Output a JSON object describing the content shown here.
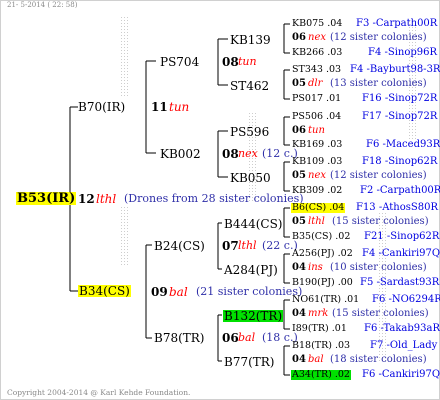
{
  "stamp": "21- 5-2014 ( 22: 58)",
  "copyright": "Copyright 2004-2014 @ Karl Kehde Foundation.",
  "root": {
    "name": "B53(IR)",
    "gen": "12",
    "mark": "lthl",
    "note": "(Drones from 28 sister colonies)"
  },
  "parents": [
    {
      "name": "B70(IR)",
      "gen": "11",
      "mark": "tun",
      "note": ""
    },
    {
      "name": "B34(CS)",
      "gen": "09",
      "mark": "bal",
      "note": "(21 sister colonies)"
    }
  ],
  "grandparents": [
    {
      "name": "PS704",
      "gen": "08",
      "mark": "tun",
      "note": ""
    },
    {
      "name": "KB002",
      "gen": "08",
      "mark": "nex",
      "note": "(12 c.)"
    },
    {
      "name": "B24(CS)",
      "gen": "07",
      "mark": "lthl",
      "note": "(22 c.)"
    },
    {
      "name": "B78(TR)",
      "gen": "06",
      "mark": "bal",
      "note": "(18 c.)"
    }
  ],
  "great": [
    {
      "name": "KB139"
    },
    {
      "name": "ST462"
    },
    {
      "name": "PS596"
    },
    {
      "name": "KB050"
    },
    {
      "name": "B444(CS)"
    },
    {
      "name": "A284(PJ)"
    },
    {
      "name": "B132(TR)"
    },
    {
      "name": "B77(TR)"
    }
  ],
  "leaves": [
    {
      "left": "KB075 .04",
      "right": "F3 -Carpath00R"
    },
    {
      "gen": "06",
      "mark": "nex",
      "note": "(12 sister colonies)"
    },
    {
      "left": "KB266 .03",
      "right": "F4 -Sinop96R"
    },
    {
      "left": "ST343 .03",
      "right": "F4 -Bayburt98-3R"
    },
    {
      "gen": "05",
      "mark": "dlr",
      "note": "(13 sister colonies)"
    },
    {
      "left": "PS017 .01",
      "right": "F16 -Sinop72R"
    },
    {
      "left": "PS506 .04",
      "right": "F17 -Sinop72R"
    },
    {
      "gen": "06",
      "mark": "tun",
      "note": ""
    },
    {
      "left": "KB169 .03",
      "right": "F6 -Maced93R"
    },
    {
      "left": "KB109 .03",
      "right": "F18 -Sinop62R"
    },
    {
      "gen": "05",
      "mark": "nex",
      "note": "(12 sister colonies)"
    },
    {
      "left": "KB309 .02",
      "right": "F2 -Carpath00R"
    },
    {
      "left": "B6(CS) .04",
      "right": "F13 -AthosS80R"
    },
    {
      "gen": "05",
      "mark": "lthl",
      "note": "(15 sister colonies)"
    },
    {
      "left": "B35(CS) .02",
      "right": "F21 -Sinop62R"
    },
    {
      "left": "A256(PJ) .02",
      "right": "F4 -Cankiri97Q"
    },
    {
      "gen": "04",
      "mark": "ins",
      "note": "(10 sister colonies)"
    },
    {
      "left": "B190(PJ) .00",
      "right": "F5 -Sardast93R"
    },
    {
      "left": "NO61(TR) .01",
      "right": "F6 -NO6294R"
    },
    {
      "gen": "04",
      "mark": "mrk",
      "note": "(15 sister colonies)"
    },
    {
      "left": "I89(TR) .01",
      "right": "F6 -Takab93aR"
    },
    {
      "left": "B18(TR) .03",
      "right": "F7 -Old_Lady"
    },
    {
      "gen": "04",
      "mark": "bal",
      "note": "(18 sister colonies)"
    },
    {
      "left": "A34(TR) .02",
      "right": "F6 -Cankiri97Q"
    }
  ]
}
